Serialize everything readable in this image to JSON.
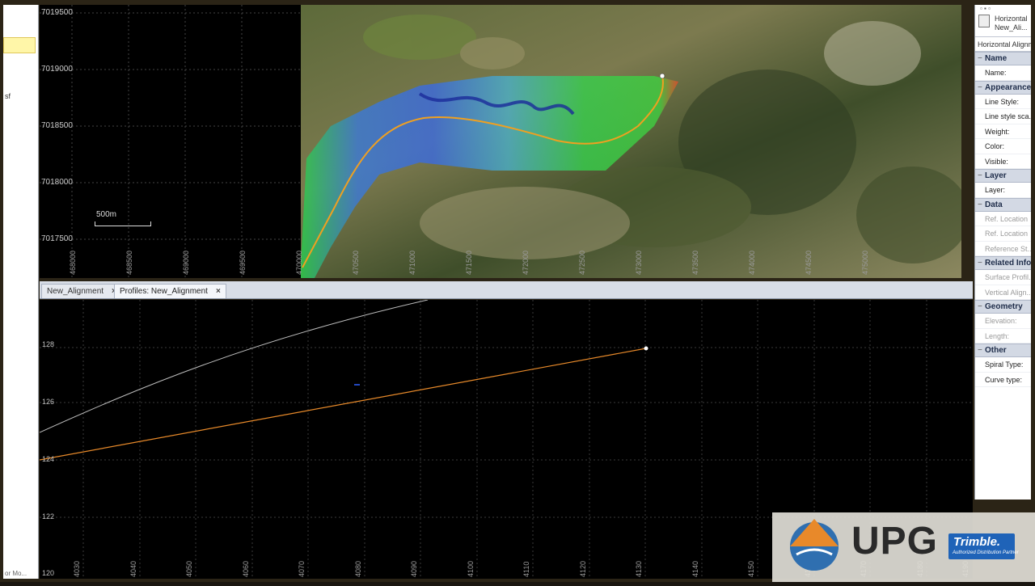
{
  "left_panel": {
    "label_sf": "sf",
    "bottom_text": "or Mo..."
  },
  "plan_view": {
    "y_ticks": [
      "7019500",
      "7019000",
      "7018500",
      "7018000",
      "7017500"
    ],
    "x_ticks": [
      "468000",
      "468500",
      "469000",
      "469500",
      "470000",
      "470500",
      "471000",
      "471500",
      "472000",
      "472500",
      "473000",
      "473500",
      "474000",
      "474500",
      "475000"
    ],
    "scale_label": "500m"
  },
  "tabs": [
    {
      "label": "New_Alignment",
      "close": "×",
      "active": false
    },
    {
      "label": "Profiles: New_Alignment",
      "close": "×",
      "active": true
    }
  ],
  "profile_view": {
    "y_ticks": [
      "128",
      "126",
      "124",
      "122",
      "120"
    ],
    "x_ticks": [
      "4030",
      "4040",
      "4050",
      "4060",
      "4070",
      "4080",
      "4090",
      "4100",
      "4110",
      "4120",
      "4130",
      "4140",
      "4150",
      "4160",
      "4170",
      "4180",
      "4190"
    ]
  },
  "properties": {
    "title_line1": "Horizontal",
    "title_line2": "New_Ali...",
    "type": "Horizontal Alignm...",
    "sections": [
      {
        "title": "Name",
        "rows": [
          {
            "label": "Name:",
            "disabled": false
          }
        ]
      },
      {
        "title": "Appearance",
        "rows": [
          {
            "label": "Line Style:",
            "disabled": false
          },
          {
            "label": "Line style sca...",
            "disabled": false
          },
          {
            "label": "Weight:",
            "disabled": false
          },
          {
            "label": "Color:",
            "disabled": false
          },
          {
            "label": "Visible:",
            "disabled": false
          }
        ]
      },
      {
        "title": "Layer",
        "rows": [
          {
            "label": "Layer:",
            "disabled": false
          }
        ]
      },
      {
        "title": "Data",
        "rows": [
          {
            "label": "Ref. Location",
            "disabled": true
          },
          {
            "label": "Ref. Location",
            "disabled": true
          },
          {
            "label": "Reference St...",
            "disabled": true
          }
        ]
      },
      {
        "title": "Related Info",
        "rows": [
          {
            "label": "Surface Profil...",
            "disabled": true
          },
          {
            "label": "Vertical Align...",
            "disabled": true
          }
        ]
      },
      {
        "title": "Geometry",
        "rows": [
          {
            "label": "Elevation:",
            "disabled": true
          },
          {
            "label": "Length:",
            "disabled": true
          }
        ]
      },
      {
        "title": "Other",
        "rows": [
          {
            "label": "Spiral Type:",
            "disabled": false
          },
          {
            "label": "Curve type:",
            "disabled": false
          }
        ]
      }
    ]
  },
  "logo": {
    "upg": "UPG",
    "trimble": "Trimble.",
    "trimble_sub": "Authorized Distribution Partner"
  },
  "colors": {
    "alignment": "#f0a020",
    "profile_line": "#e88a2a",
    "ground_line": "#bdbdbd",
    "grid": "#3a3a3a",
    "section_bg": "#d3d9e4",
    "tab_bg": "#d8dde6"
  }
}
